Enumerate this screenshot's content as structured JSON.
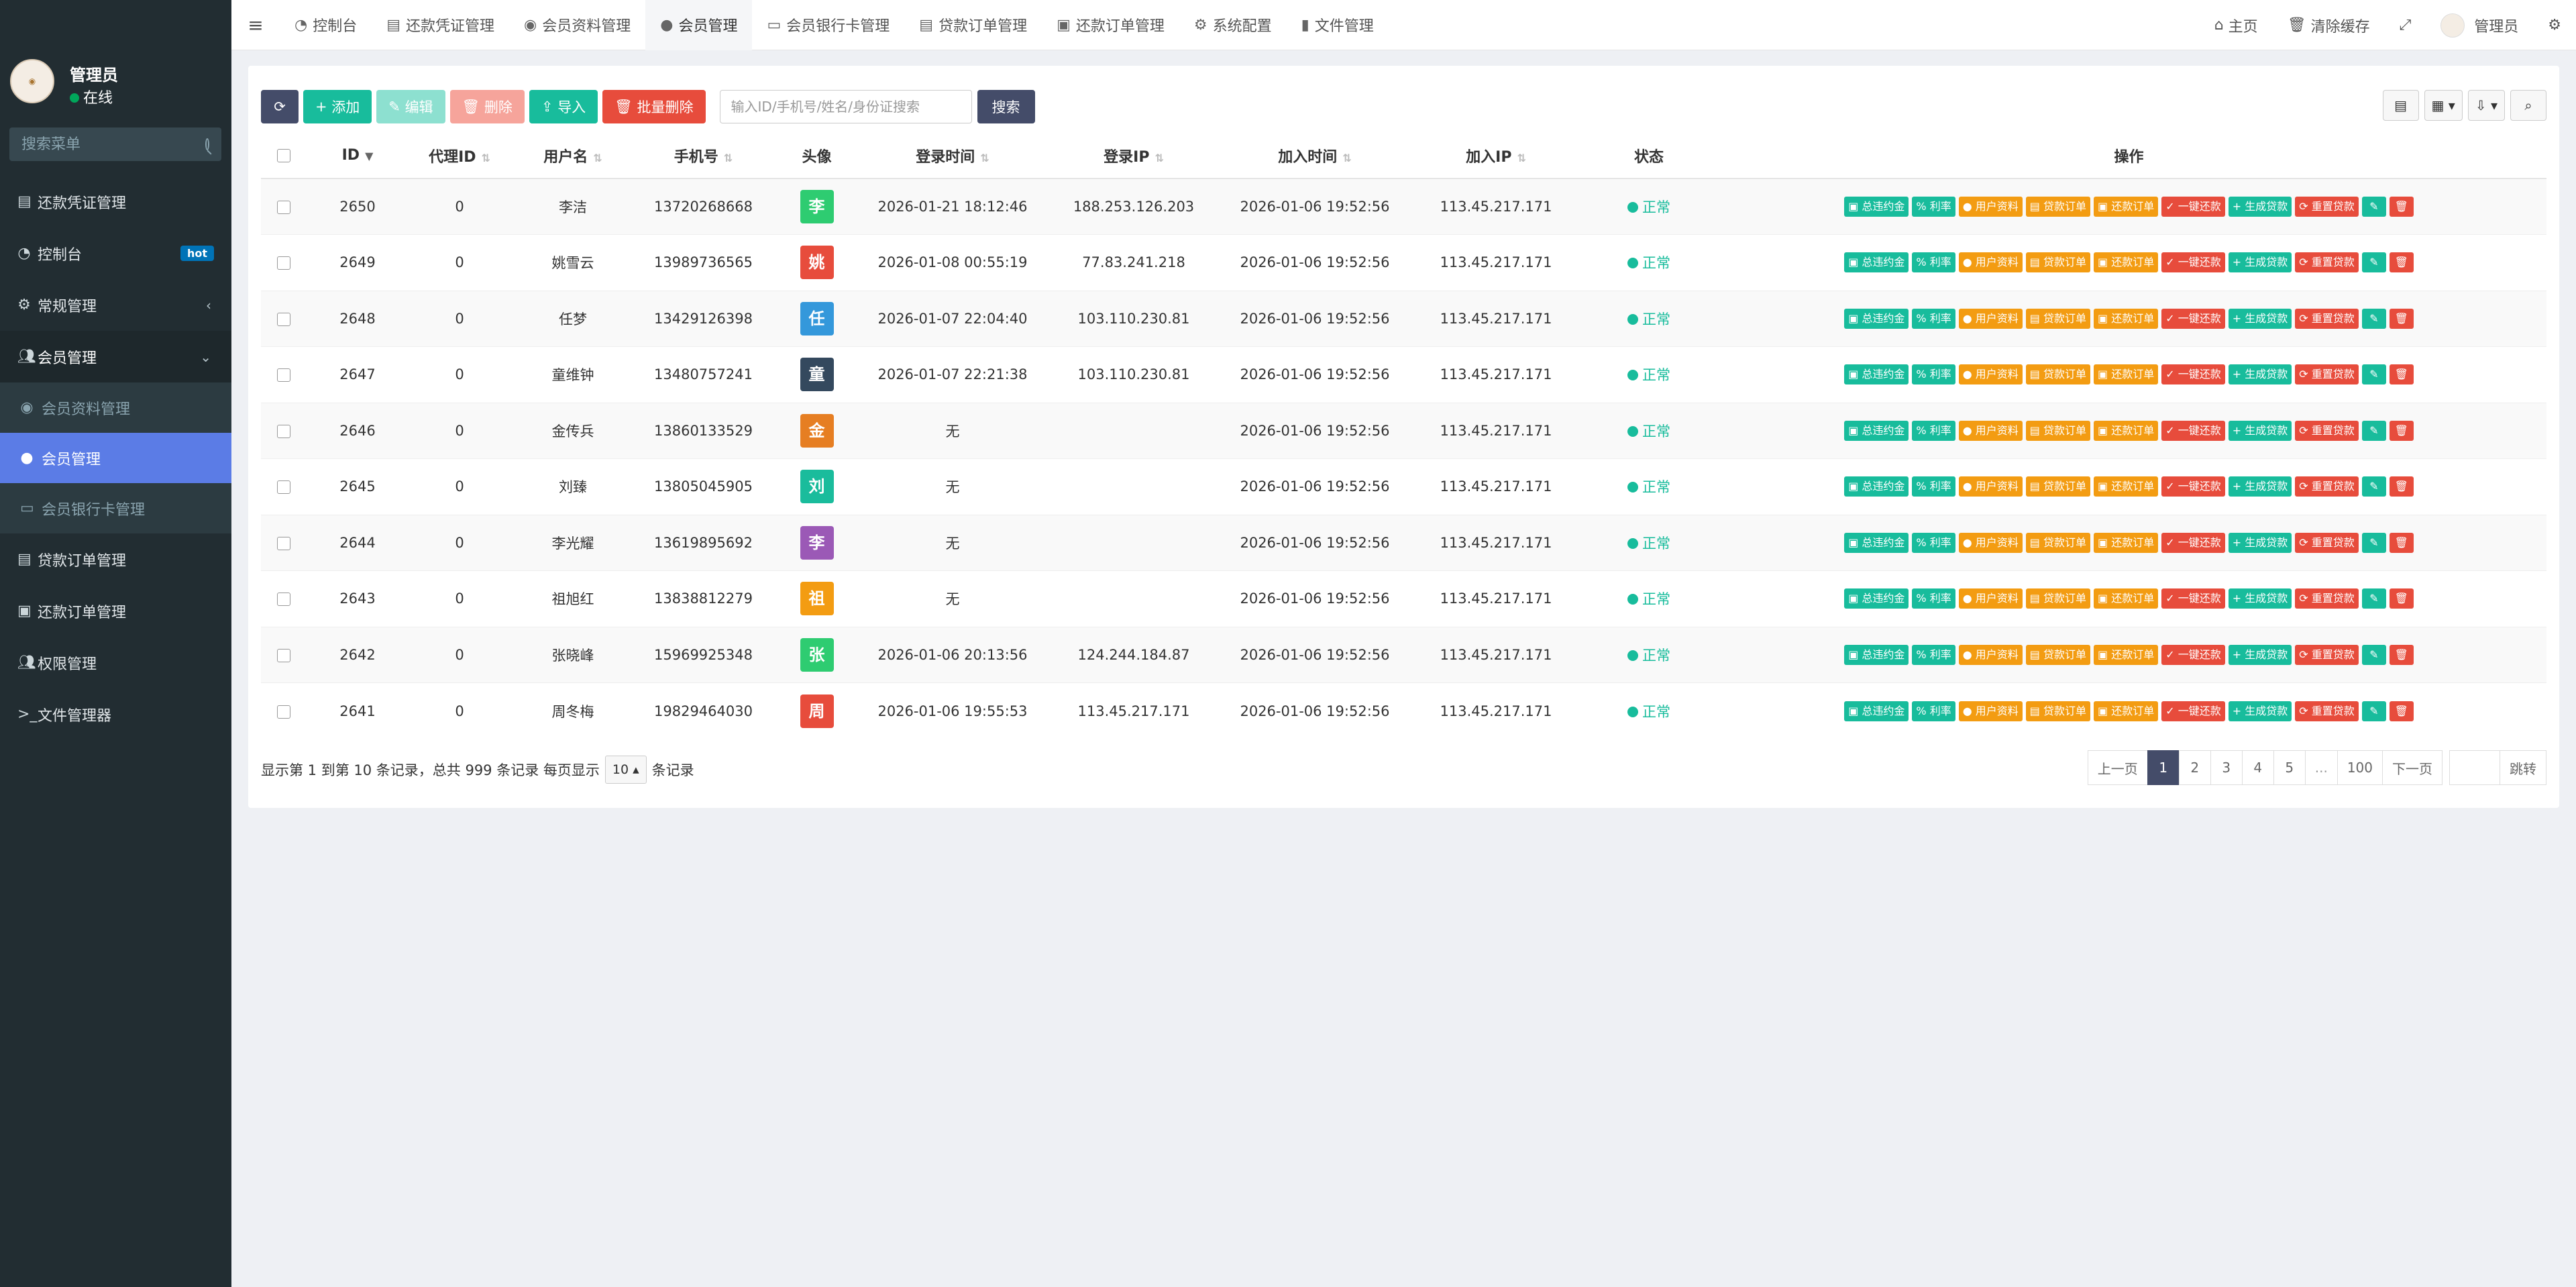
{
  "sidebar": {
    "user": {
      "name": "管理员",
      "status": "在线"
    },
    "search_placeholder": "搜索菜单",
    "items": [
      {
        "label": "还款凭证管理",
        "icon": "document-icon"
      },
      {
        "label": "控制台",
        "icon": "dashboard-icon",
        "badge": "hot"
      },
      {
        "label": "常规管理",
        "icon": "cogs-icon"
      },
      {
        "label": "会员管理",
        "icon": "users-icon"
      }
    ],
    "sub_items": [
      {
        "label": "会员资料管理",
        "icon": "user-circle-icon"
      },
      {
        "label": "会员管理",
        "icon": "user-icon"
      },
      {
        "label": "会员银行卡管理",
        "icon": "credit-card-icon"
      }
    ],
    "items_after": [
      {
        "label": "贷款订单管理",
        "icon": "document-icon"
      },
      {
        "label": "还款订单管理",
        "icon": "money-icon"
      },
      {
        "label": "权限管理",
        "icon": "users-icon"
      },
      {
        "label": "文件管理器",
        "icon": "terminal-icon"
      }
    ]
  },
  "topbar": {
    "tabs": [
      {
        "label": "控制台"
      },
      {
        "label": "还款凭证管理"
      },
      {
        "label": "会员资料管理"
      },
      {
        "label": "会员管理"
      },
      {
        "label": "会员银行卡管理"
      },
      {
        "label": "贷款订单管理"
      },
      {
        "label": "还款订单管理"
      },
      {
        "label": "系统配置"
      },
      {
        "label": "文件管理"
      }
    ],
    "home": "主页",
    "clear_cache": "清除缓存",
    "admin": "管理员"
  },
  "toolbar": {
    "add": "添加",
    "edit": "编辑",
    "delete": "删除",
    "import": "导入",
    "batch_delete": "批量删除",
    "search_placeholder": "输入ID/手机号/姓名/身份证搜索",
    "search": "搜索"
  },
  "table": {
    "headers": {
      "id": "ID",
      "agent_id": "代理ID",
      "username": "用户名",
      "phone": "手机号",
      "avatar": "头像",
      "login_time": "登录时间",
      "login_ip": "登录IP",
      "join_time": "加入时间",
      "join_ip": "加入IP",
      "status": "状态",
      "actions": "操作"
    },
    "actions": [
      "总违约金",
      "利率",
      "用户资料",
      "贷款订单",
      "还款订单",
      "一键还款",
      "生成贷款",
      "重置贷款"
    ],
    "rows": [
      {
        "id": "2650",
        "agent_id": "0",
        "username": "李洁",
        "phone": "13720268668",
        "avatar": "李",
        "avatar_color": "#2ecc71",
        "login_time": "2026-01-21 18:12:46",
        "login_ip": "188.253.126.203",
        "join_time": "2026-01-06 19:52:56",
        "join_ip": "113.45.217.171",
        "status": "正常"
      },
      {
        "id": "2649",
        "agent_id": "0",
        "username": "姚雪云",
        "phone": "13989736565",
        "avatar": "姚",
        "avatar_color": "#e74c3c",
        "login_time": "2026-01-08 00:55:19",
        "login_ip": "77.83.241.218",
        "join_time": "2026-01-06 19:52:56",
        "join_ip": "113.45.217.171",
        "status": "正常"
      },
      {
        "id": "2648",
        "agent_id": "0",
        "username": "任梦",
        "phone": "13429126398",
        "avatar": "任",
        "avatar_color": "#3498db",
        "login_time": "2026-01-07 22:04:40",
        "login_ip": "103.110.230.81",
        "join_time": "2026-01-06 19:52:56",
        "join_ip": "113.45.217.171",
        "status": "正常"
      },
      {
        "id": "2647",
        "agent_id": "0",
        "username": "童维钟",
        "phone": "13480757241",
        "avatar": "童",
        "avatar_color": "#34495e",
        "login_time": "2026-01-07 22:21:38",
        "login_ip": "103.110.230.81",
        "join_time": "2026-01-06 19:52:56",
        "join_ip": "113.45.217.171",
        "status": "正常"
      },
      {
        "id": "2646",
        "agent_id": "0",
        "username": "金传兵",
        "phone": "13860133529",
        "avatar": "金",
        "avatar_color": "#e67e22",
        "login_time": "无",
        "login_ip": "",
        "join_time": "2026-01-06 19:52:56",
        "join_ip": "113.45.217.171",
        "status": "正常"
      },
      {
        "id": "2645",
        "agent_id": "0",
        "username": "刘臻",
        "phone": "13805045905",
        "avatar": "刘",
        "avatar_color": "#1abc9c",
        "login_time": "无",
        "login_ip": "",
        "join_time": "2026-01-06 19:52:56",
        "join_ip": "113.45.217.171",
        "status": "正常"
      },
      {
        "id": "2644",
        "agent_id": "0",
        "username": "李光耀",
        "phone": "13619895692",
        "avatar": "李",
        "avatar_color": "#9b59b6",
        "login_time": "无",
        "login_ip": "",
        "join_time": "2026-01-06 19:52:56",
        "join_ip": "113.45.217.171",
        "status": "正常"
      },
      {
        "id": "2643",
        "agent_id": "0",
        "username": "祖旭红",
        "phone": "13838812279",
        "avatar": "祖",
        "avatar_color": "#f39c12",
        "login_time": "无",
        "login_ip": "",
        "join_time": "2026-01-06 19:52:56",
        "join_ip": "113.45.217.171",
        "status": "正常"
      },
      {
        "id": "2642",
        "agent_id": "0",
        "username": "张晓峰",
        "phone": "15969925348",
        "avatar": "张",
        "avatar_color": "#2ecc71",
        "login_time": "2026-01-06 20:13:56",
        "login_ip": "124.244.184.87",
        "join_time": "2026-01-06 19:52:56",
        "join_ip": "113.45.217.171",
        "status": "正常"
      },
      {
        "id": "2641",
        "agent_id": "0",
        "username": "周冬梅",
        "phone": "19829464030",
        "avatar": "周",
        "avatar_color": "#e74c3c",
        "login_time": "2026-01-06 19:55:53",
        "login_ip": "113.45.217.171",
        "join_time": "2026-01-06 19:52:56",
        "join_ip": "113.45.217.171",
        "status": "正常"
      }
    ]
  },
  "footer": {
    "info_prefix": "显示第 1 到第 10 条记录，总共 999 条记录 每页显示",
    "page_size": "10",
    "info_suffix": "条记录"
  },
  "pagination": {
    "prev": "上一页",
    "pages": [
      "1",
      "2",
      "3",
      "4",
      "5",
      "...",
      "100"
    ],
    "next": "下一页",
    "jump": "跳转"
  }
}
